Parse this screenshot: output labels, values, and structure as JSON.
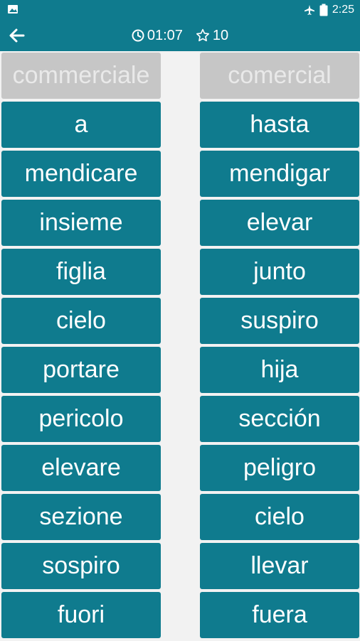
{
  "status_bar": {
    "time": "2:25",
    "left_icon": "image-icon",
    "right_icons": [
      "airplane-mode-icon",
      "battery-icon"
    ]
  },
  "header": {
    "back_icon": "arrow-left-icon",
    "timer": "01:07",
    "timer_icon": "clock-icon",
    "stars": "10",
    "star_icon": "star-outline-icon"
  },
  "colors": {
    "primary": "#0f7b8e",
    "completed_tile": "#c6c6c6",
    "completed_text": "#e9e9e9",
    "background": "#f2f2f2"
  },
  "left_words": [
    {
      "text": "commerciale",
      "completed": true
    },
    {
      "text": "a",
      "completed": false
    },
    {
      "text": "mendicare",
      "completed": false
    },
    {
      "text": "insieme",
      "completed": false
    },
    {
      "text": "figlia",
      "completed": false
    },
    {
      "text": "cielo",
      "completed": false
    },
    {
      "text": "portare",
      "completed": false
    },
    {
      "text": "pericolo",
      "completed": false
    },
    {
      "text": "elevare",
      "completed": false
    },
    {
      "text": "sezione",
      "completed": false
    },
    {
      "text": "sospiro",
      "completed": false
    },
    {
      "text": "fuori",
      "completed": false
    }
  ],
  "right_words": [
    {
      "text": "comercial",
      "completed": true
    },
    {
      "text": "hasta",
      "completed": false
    },
    {
      "text": "mendigar",
      "completed": false
    },
    {
      "text": "elevar",
      "completed": false
    },
    {
      "text": "junto",
      "completed": false
    },
    {
      "text": "suspiro",
      "completed": false
    },
    {
      "text": "hija",
      "completed": false
    },
    {
      "text": "sección",
      "completed": false
    },
    {
      "text": "peligro",
      "completed": false
    },
    {
      "text": "cielo",
      "completed": false
    },
    {
      "text": "llevar",
      "completed": false
    },
    {
      "text": "fuera",
      "completed": false
    }
  ]
}
